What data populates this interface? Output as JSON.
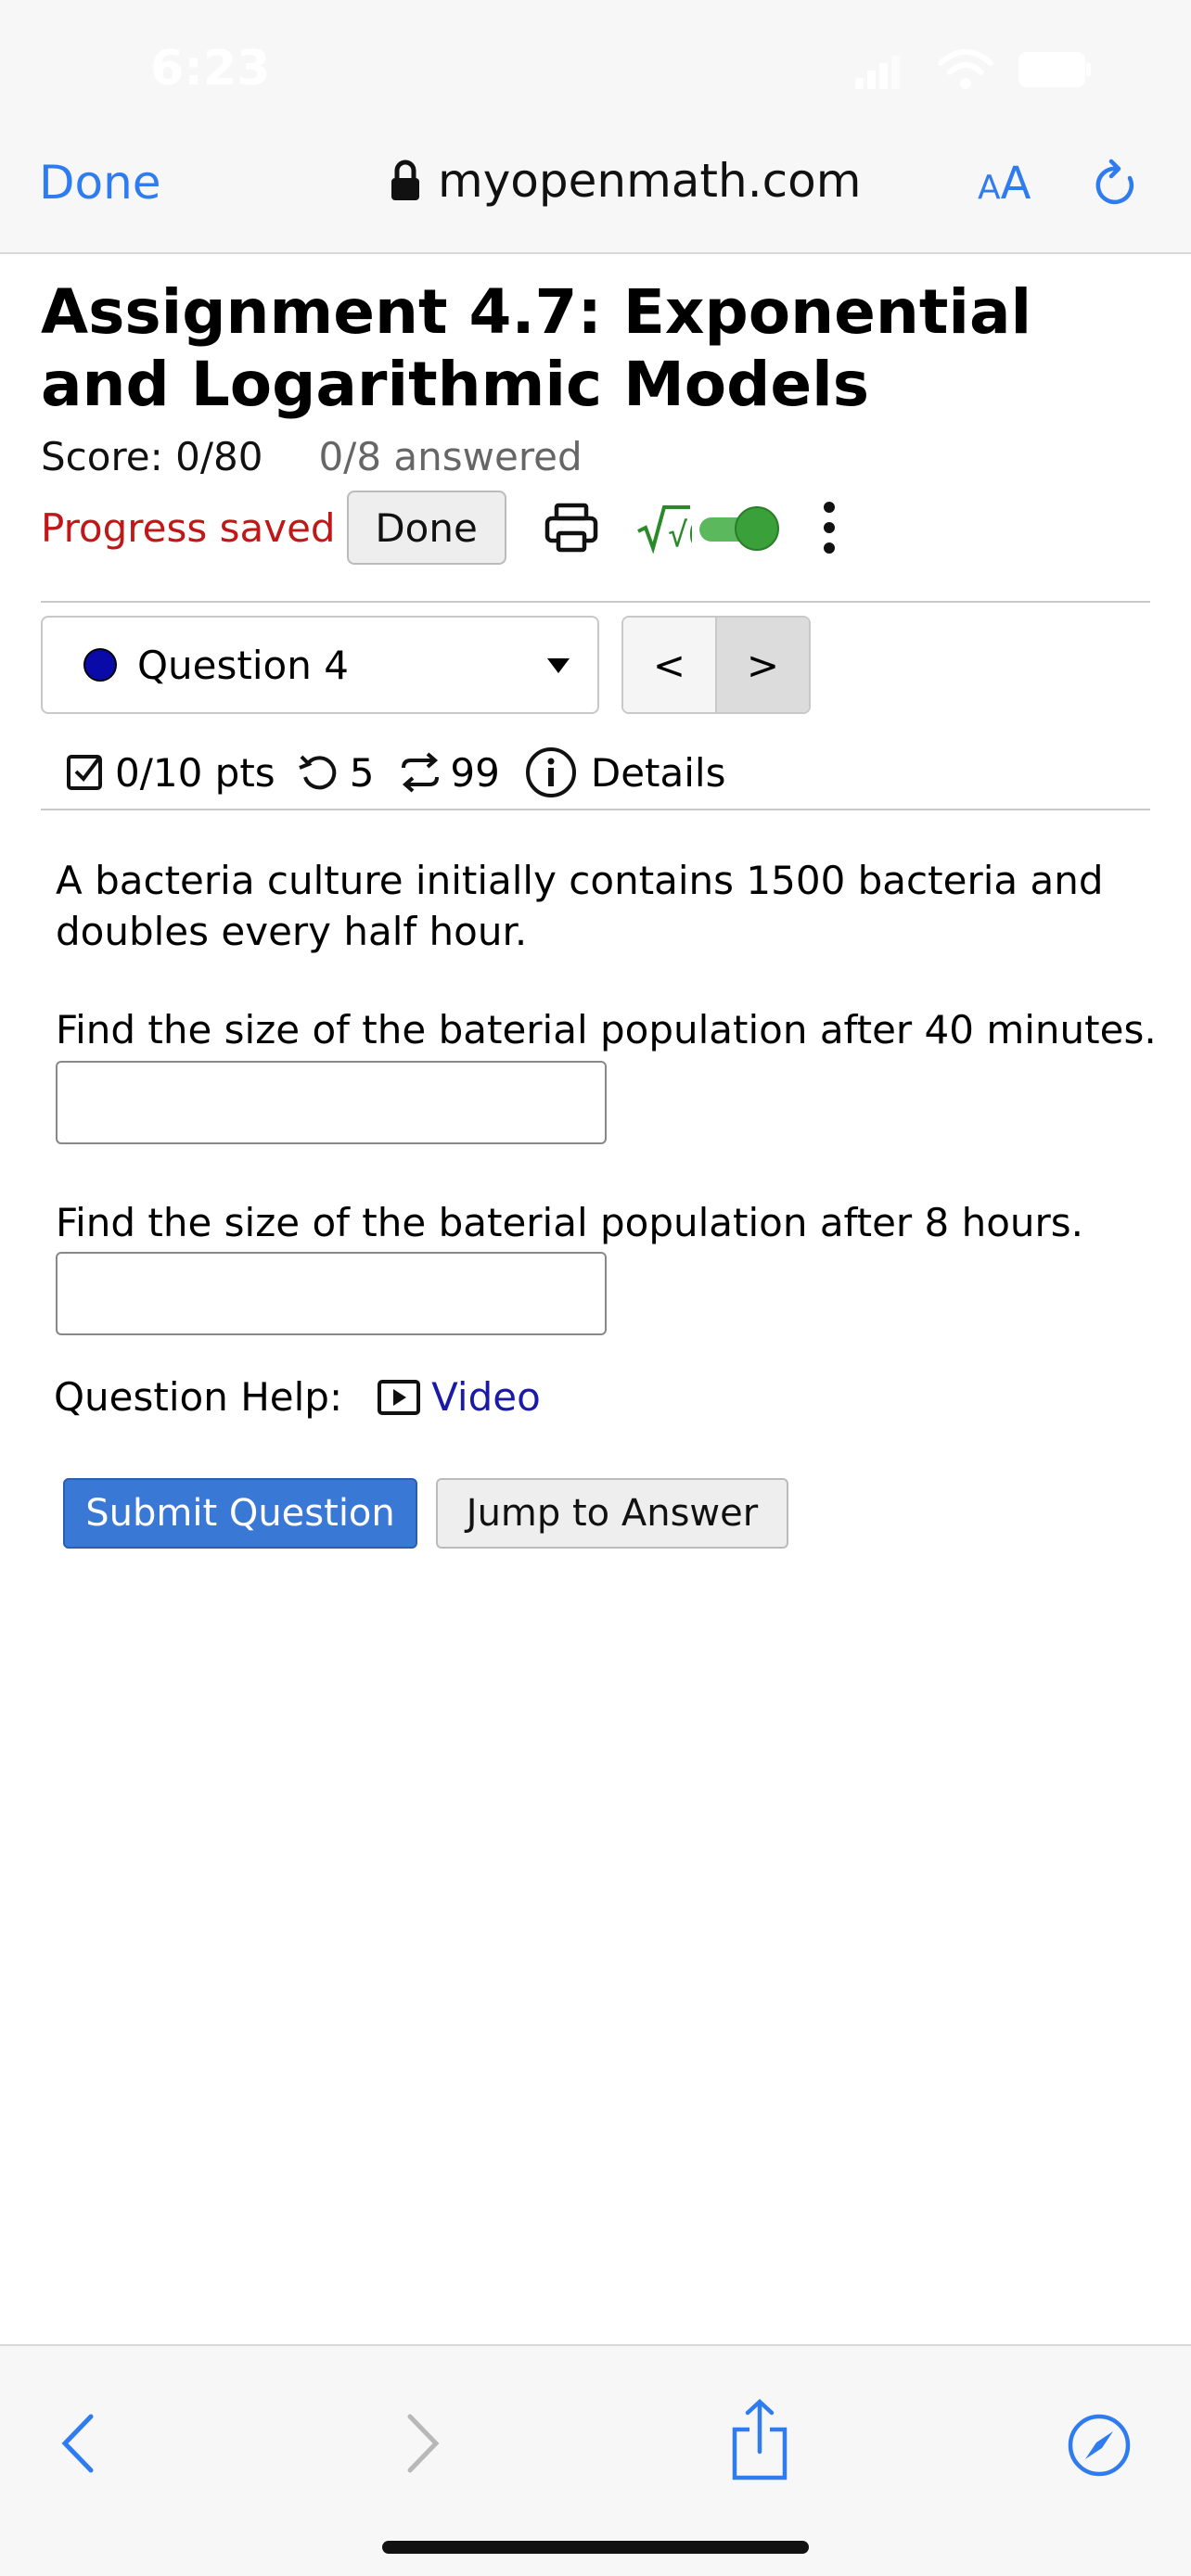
{
  "status_bar": {
    "time": "6:23"
  },
  "browser": {
    "done_label": "Done",
    "url": "myopenmath.com",
    "aa_small": "A",
    "aa_large": "A"
  },
  "assignment": {
    "title": "Assignment 4.7: Exponential and Logarithmic Models",
    "score": "Score: 0/80",
    "answered": "0/8 answered",
    "progress": "Progress saved",
    "done_button": "Done",
    "sqrt_symbol": "√0"
  },
  "question_nav": {
    "selected": "Question 4",
    "prev": "<",
    "next": ">"
  },
  "question_meta": {
    "points": "0/10 pts",
    "retries": "5",
    "attempts": "99",
    "details": "Details"
  },
  "question": {
    "text": "A bacteria culture initially contains 1500 bacteria and doubles every half hour.",
    "part1_prompt": "Find the size of the baterial population after 40 minutes.",
    "part1_value": "",
    "part2_prompt": "Find the size of the baterial population after 8 hours.",
    "part2_value": "",
    "help_label": "Question Help:",
    "video_label": "Video",
    "submit_label": "Submit Question",
    "jump_label": "Jump to Answer"
  },
  "colors": {
    "accent_blue": "#2f7bf0",
    "progress_red": "#c01818",
    "toggle_green": "#3aa13a",
    "submit_blue": "#3a78d6",
    "link_blue": "#1a1aa8"
  }
}
